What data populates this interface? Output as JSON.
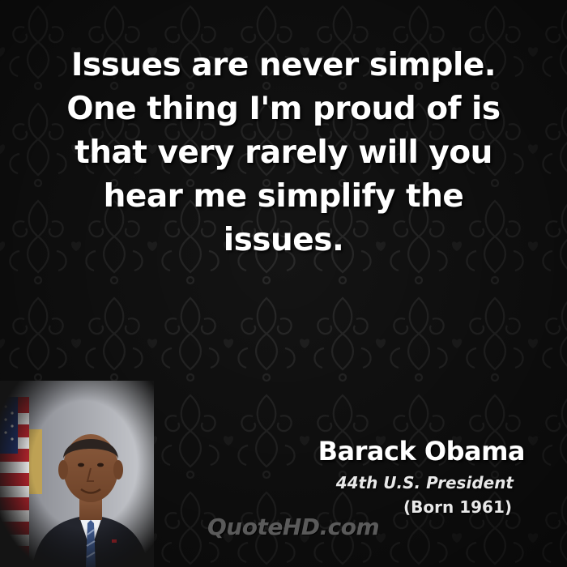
{
  "quote": {
    "lines": [
      "Issues are never simple.",
      "One thing I'm proud of is",
      "that very rarely will you",
      "hear me simplify the",
      "issues."
    ]
  },
  "author": {
    "name": "Barack Obama",
    "title": "44th U.S. President",
    "born": "(Born 1961)"
  },
  "watermark": {
    "text": "QuoteHD.com"
  },
  "portrait": {
    "icon": "person-portrait-with-flag"
  },
  "colors": {
    "background": "#111111",
    "quote_text": "#ffffff",
    "watermark": "#5a5a5a"
  }
}
